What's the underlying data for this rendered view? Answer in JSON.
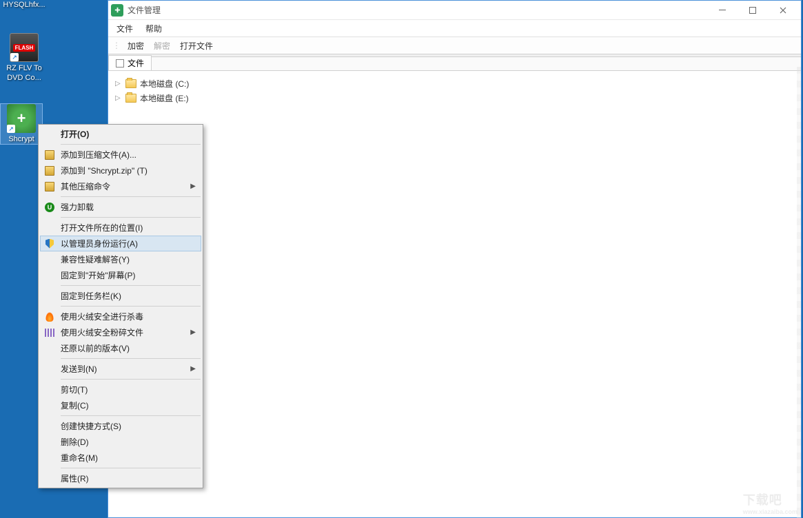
{
  "desktop": {
    "icons": [
      {
        "name": "mysql",
        "label": "HYSQLhfx..."
      },
      {
        "name": "flv",
        "label": "RZ FLV To DVD Co...",
        "badge": "FLASH"
      },
      {
        "name": "shcrypt",
        "label": "Shcrypt"
      }
    ]
  },
  "app": {
    "title": "文件管理",
    "menubar": [
      "文件",
      "帮助"
    ],
    "toolbar": {
      "encrypt": "加密",
      "decrypt": "解密",
      "openfile": "打开文件"
    },
    "tab_label": "文件",
    "tree": [
      {
        "label": "本地磁盘 (C:)"
      },
      {
        "label": "本地磁盘 (E:)"
      }
    ]
  },
  "context_menu": {
    "open": "打开(O)",
    "add_archive": "添加到压缩文件(A)...",
    "add_zip": "添加到 \"Shcrypt.zip\" (T)",
    "other_compress": "其他压缩命令",
    "force_uninstall": "强力卸载",
    "open_location": "打开文件所在的位置(I)",
    "run_as_admin": "以管理员身份运行(A)",
    "compat": "兼容性疑难解答(Y)",
    "pin_start": "固定到\"开始\"屏幕(P)",
    "pin_taskbar": "固定到任务栏(K)",
    "huorong_scan": "使用火绒安全进行杀毒",
    "huorong_shred": "使用火绒安全粉碎文件",
    "restore_prev": "还原以前的版本(V)",
    "send_to": "发送到(N)",
    "cut": "剪切(T)",
    "copy": "复制(C)",
    "create_shortcut": "创建快捷方式(S)",
    "delete": "删除(D)",
    "rename": "重命名(M)",
    "properties": "属性(R)"
  },
  "watermark": {
    "main": "下载吧",
    "sub": "www.xiazaiba.com"
  }
}
